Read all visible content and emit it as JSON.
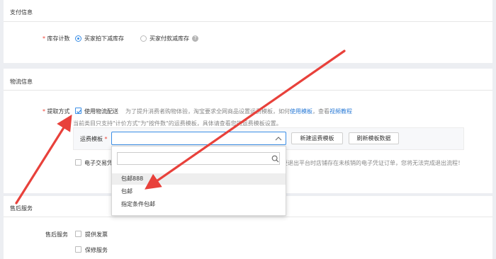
{
  "payment_section": {
    "title": "支付信息",
    "stock_label": "库存计数",
    "required_mark": "*",
    "options": [
      "买家拍下减库存",
      "买家付款减库存"
    ],
    "selected": "买家拍下减库存",
    "help_glyph": "?"
  },
  "logistics_section": {
    "title": "物流信息",
    "pickup_label": "提取方式",
    "use_logistics_label": "使用物流配送",
    "hint_prefix": "为了提升消费者购物体验，淘宝要求全网商品设置运费模板，如何",
    "hint_link": "使用模板",
    "hint_mid": "，查看",
    "hint_link2": "视频教程",
    "notice": "当前类目只支持\"计价方式\"为\"按件数\"的运费模板，具体请查看您的运费模板设置。",
    "template_label": "运费模板",
    "template_value": "",
    "new_template_button": "新建运费模板",
    "refresh_button": "刷新模板数据",
    "dropdown_search_value": "",
    "dropdown_options": [
      "包邮888",
      "包邮",
      "指定条件包邮"
    ],
    "hovered_option": "包邮888",
    "evoucher_label": "电子交易凭",
    "evoucher_notice": "要退出平台时店铺存在未核销的电子凭证订单，您将无法完成退出流程！"
  },
  "after_sales_section": {
    "title": "售后服务",
    "service_label": "售后服务",
    "options": [
      "提供发票",
      "保修服务"
    ]
  },
  "colors": {
    "accent": "#3a8ee6",
    "required": "#f04134",
    "annotation_arrow": "#e8413b",
    "link": "#2b7bd6"
  },
  "icons": [
    "check-icon",
    "help-icon",
    "chevron-up-icon",
    "search-icon",
    "annotation-arrow"
  ]
}
